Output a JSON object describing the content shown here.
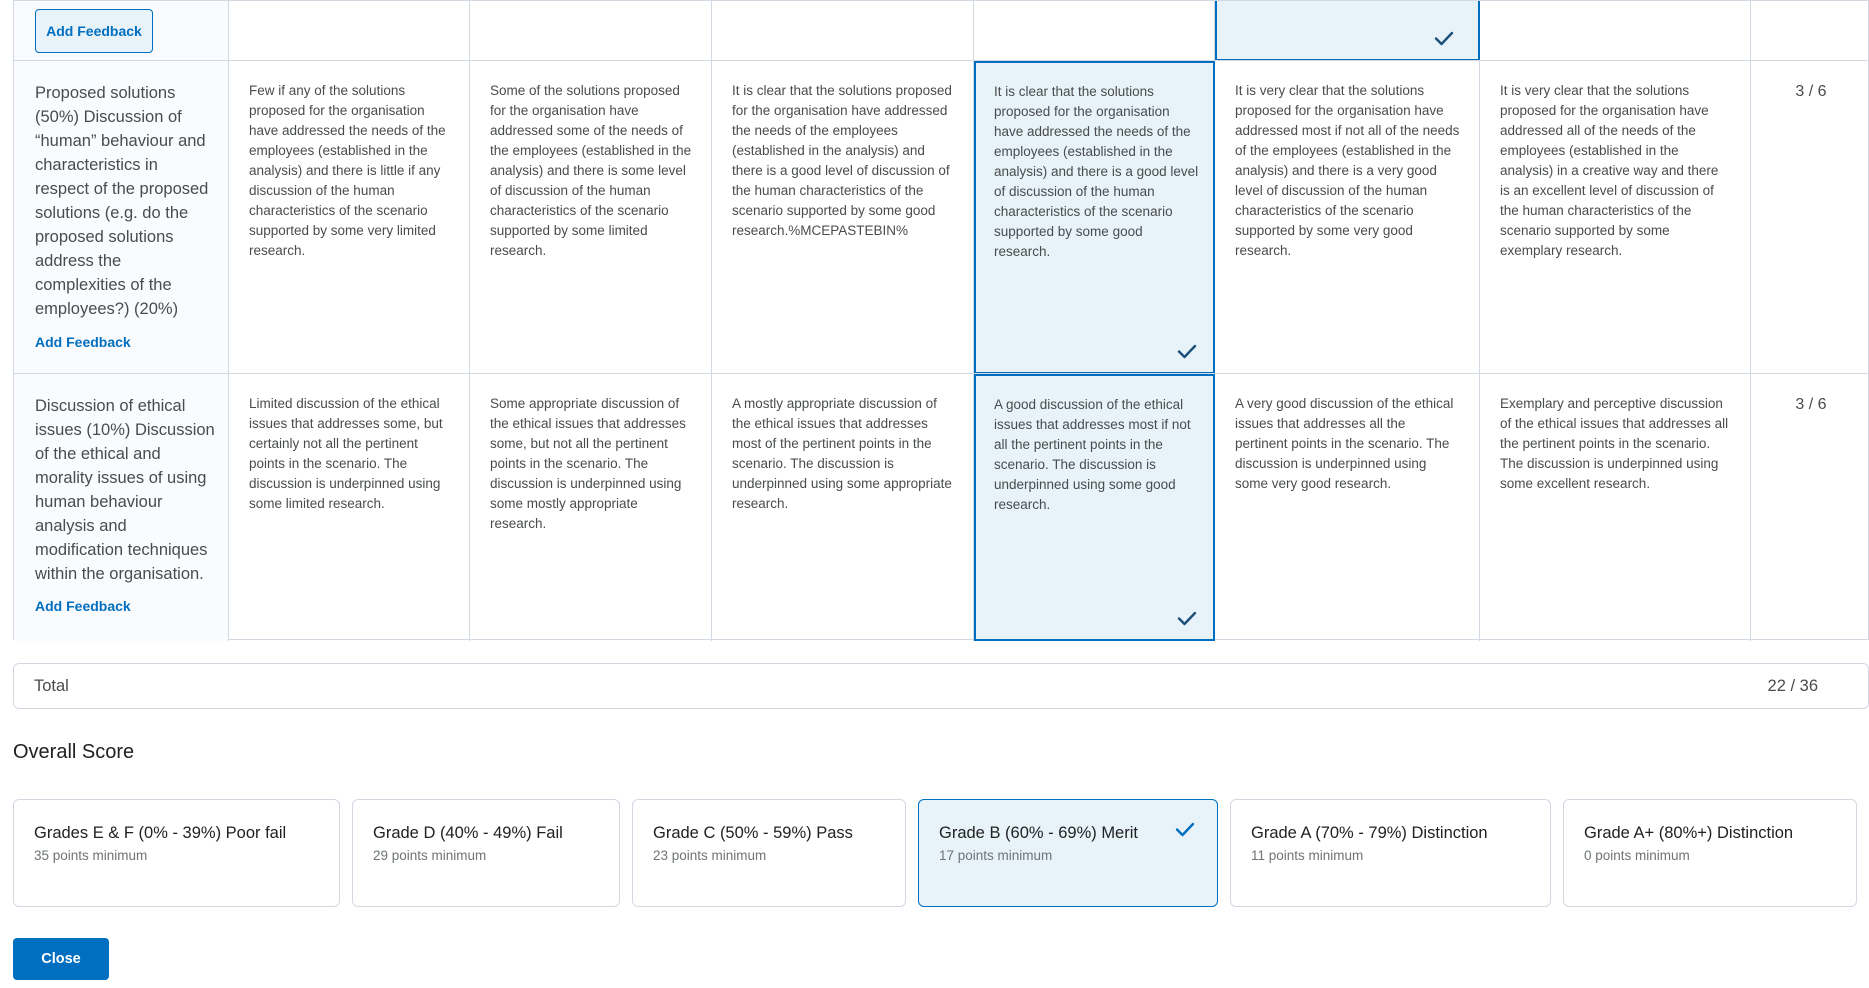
{
  "rubric": {
    "top_row": {
      "add_feedback_label": "Add Feedback"
    },
    "rows": [
      {
        "criterion": "Proposed solutions (50%) Discussion of “human” behaviour and characteristics in respect of the proposed solutions (e.g. do the proposed solutions address the complexities of the employees?) (20%)",
        "add_feedback_label": "Add Feedback",
        "levels": [
          "Few if any of the solutions proposed for the organisation have addressed the needs of the employees (established in the analysis) and there is little if any discussion of the human characteristics of the scenario supported by some very limited research.",
          "Some of the solutions proposed for the organisation have addressed some of the needs of the employees (established in the analysis) and there is some level of discussion of the human characteristics of the scenario supported by some limited research.",
          "It is clear that the solutions proposed for the organisation have addressed the needs of the employees (established in the analysis) and there is a good level of discussion of the human characteristics of the scenario supported by some good research.%MCEPASTEBIN%",
          "It is clear that the solutions proposed for the organisation have addressed the needs of the employees (established in the analysis) and there is a good level of discussion of the human characteristics of the scenario supported by some good research.",
          "It is very clear that the solutions proposed for the organisation have addressed most if not all of the needs of the employees (established in the analysis) and there is a very good level of discussion of the human characteristics of the scenario supported by some very good research.",
          "It is very clear that the solutions proposed for the organisation have addressed all of the needs of the employees (established in the analysis) in a creative way and there is an excellent level of discussion of the human characteristics of the scenario supported by some exemplary research."
        ],
        "score": "3 / 6"
      },
      {
        "criterion": "Discussion of ethical issues (10%) Discussion of the ethical and morality issues of using human behaviour analysis and modification techniques within the organisation.",
        "add_feedback_label": "Add Feedback",
        "levels": [
          "Limited discussion of the ethical issues that addresses some, but certainly not all the pertinent points in the scenario. The discussion is underpinned using some limited research.",
          "Some appropriate discussion of the ethical issues that addresses some, but not all the pertinent points in the scenario. The discussion is underpinned using some mostly appropriate research.",
          "A mostly appropriate discussion of the ethical issues that addresses most of the pertinent points in the scenario. The discussion is underpinned using some appropriate research.",
          "A good discussion of the ethical issues that addresses most if not all the pertinent points in the scenario. The discussion is underpinned using some good research.",
          "A very good discussion of the ethical issues that addresses all the pertinent points in the scenario. The discussion is underpinned using some very good research.",
          "Exemplary and perceptive discussion of the ethical issues that addresses all the pertinent points in the scenario. The discussion is underpinned using some excellent research."
        ],
        "score": "3 / 6"
      }
    ],
    "selected_level": "Good",
    "check_icon": "checkmark-icon"
  },
  "total": {
    "label": "Total",
    "value": "22 / 36"
  },
  "overall": {
    "heading": "Overall Score",
    "grades": [
      {
        "title": "Grades E & F (0% - 39%) Poor fail",
        "sub": "35 points minimum",
        "selected": false
      },
      {
        "title": "Grade D (40% - 49%) Fail",
        "sub": "29 points minimum",
        "selected": false
      },
      {
        "title": "Grade C (50% - 59%) Pass",
        "sub": "23 points minimum",
        "selected": false
      },
      {
        "title": "Grade B (60% - 69%) Merit",
        "sub": "17 points minimum",
        "selected": true
      },
      {
        "title": "Grade A (70% - 79%) Distinction",
        "sub": "11 points minimum",
        "selected": false
      },
      {
        "title": "Grade A+ (80%+) Distinction",
        "sub": "0 points minimum",
        "selected": false
      }
    ]
  },
  "close_label": "Close",
  "colors": {
    "accent": "#006fbf",
    "selected_bg": "#e7f2f9",
    "border": "#d3d9e3"
  }
}
